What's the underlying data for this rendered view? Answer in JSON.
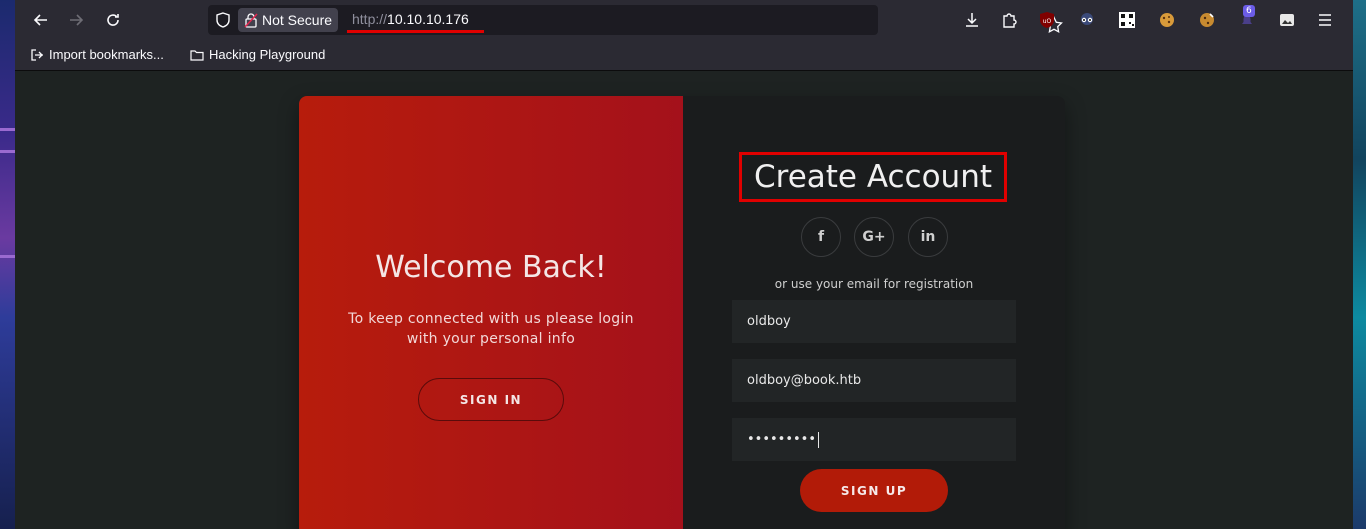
{
  "browser": {
    "security_label": "Not Secure",
    "url_protocol": "http://",
    "url_host": "10.10.10.176",
    "extension_badge": "6",
    "bookmarks": [
      {
        "label": "Import bookmarks...",
        "icon": "import-icon"
      },
      {
        "label": "Hacking Playground",
        "icon": "folder-icon"
      }
    ]
  },
  "left_panel": {
    "title": "Welcome Back!",
    "subtitle": "To keep connected with us please login with your personal info",
    "signin_label": "SIGN IN"
  },
  "right_panel": {
    "title": "Create Account",
    "social": [
      {
        "glyph": "f",
        "icon": "facebook-icon"
      },
      {
        "glyph": "G+",
        "icon": "google-plus-icon"
      },
      {
        "glyph": "in",
        "icon": "linkedin-icon"
      }
    ],
    "or_text": "or use your email for registration",
    "name_value": "oldboy",
    "email_value": "oldboy@book.htb",
    "password_mask": "•••••••••",
    "signup_label": "SIGN UP"
  },
  "colors": {
    "left_panel_start": "#b71c0c",
    "left_panel_end": "#a4111b",
    "signup_button": "#b21b08",
    "highlight": "#e00000"
  }
}
